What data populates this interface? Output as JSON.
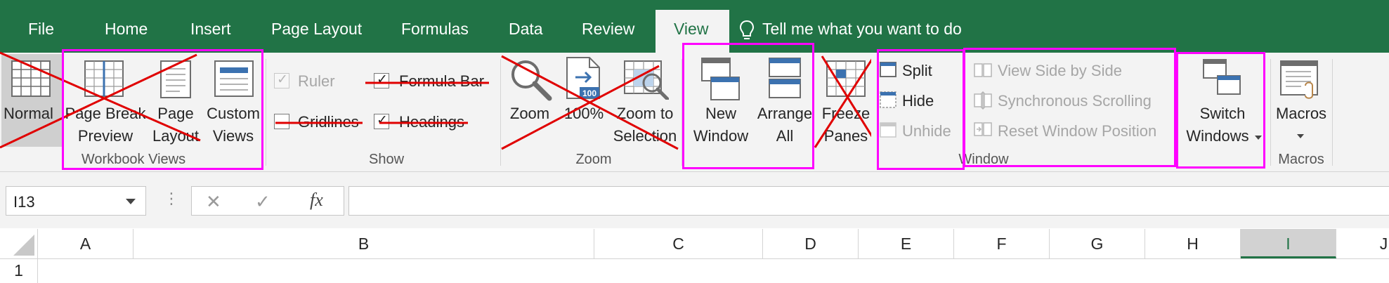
{
  "tabs": {
    "file": "File",
    "home": "Home",
    "insert": "Insert",
    "page_layout": "Page Layout",
    "formulas": "Formulas",
    "data": "Data",
    "review": "Review",
    "view": "View",
    "tell_me": "Tell me what you want to do"
  },
  "ribbon": {
    "workbook_views": {
      "group_label": "Workbook Views",
      "normal": "Normal",
      "page_break_preview": [
        "Page Break",
        "Preview"
      ],
      "page_layout": [
        "Page",
        "Layout"
      ],
      "custom_views": [
        "Custom",
        "Views"
      ]
    },
    "show": {
      "group_label": "Show",
      "ruler": "Ruler",
      "formula_bar": "Formula Bar",
      "gridlines": "Gridlines",
      "headings": "Headings"
    },
    "zoom": {
      "group_label": "Zoom",
      "zoom": "Zoom",
      "zoom_100": "100%",
      "zoom_to_selection": [
        "Zoom to",
        "Selection"
      ],
      "badge": "100"
    },
    "window": {
      "group_label": "Window",
      "new_window": [
        "New",
        "Window"
      ],
      "arrange_all": [
        "Arrange",
        "All"
      ],
      "freeze_panes": [
        "Freeze",
        "Panes"
      ],
      "split": "Split",
      "hide": "Hide",
      "unhide": "Unhide",
      "view_side_by_side": "View Side by Side",
      "synchronous_scrolling": "Synchronous Scrolling",
      "reset_window_position": "Reset Window Position",
      "switch_windows": [
        "Switch",
        "Windows"
      ]
    },
    "macros": {
      "group_label": "Macros",
      "macros": "Macros"
    }
  },
  "formula_bar": {
    "name_box": "I13",
    "cancel": "✕",
    "enter": "✓",
    "fx": "fx",
    "value": ""
  },
  "grid": {
    "columns": [
      "A",
      "B",
      "C",
      "D",
      "E",
      "F",
      "G",
      "H",
      "I",
      "J"
    ],
    "selected_column": "I",
    "rows": [
      "1"
    ]
  },
  "colors": {
    "accent": "#217346",
    "highlight": "#ff00ff",
    "strike": "#e00000"
  }
}
